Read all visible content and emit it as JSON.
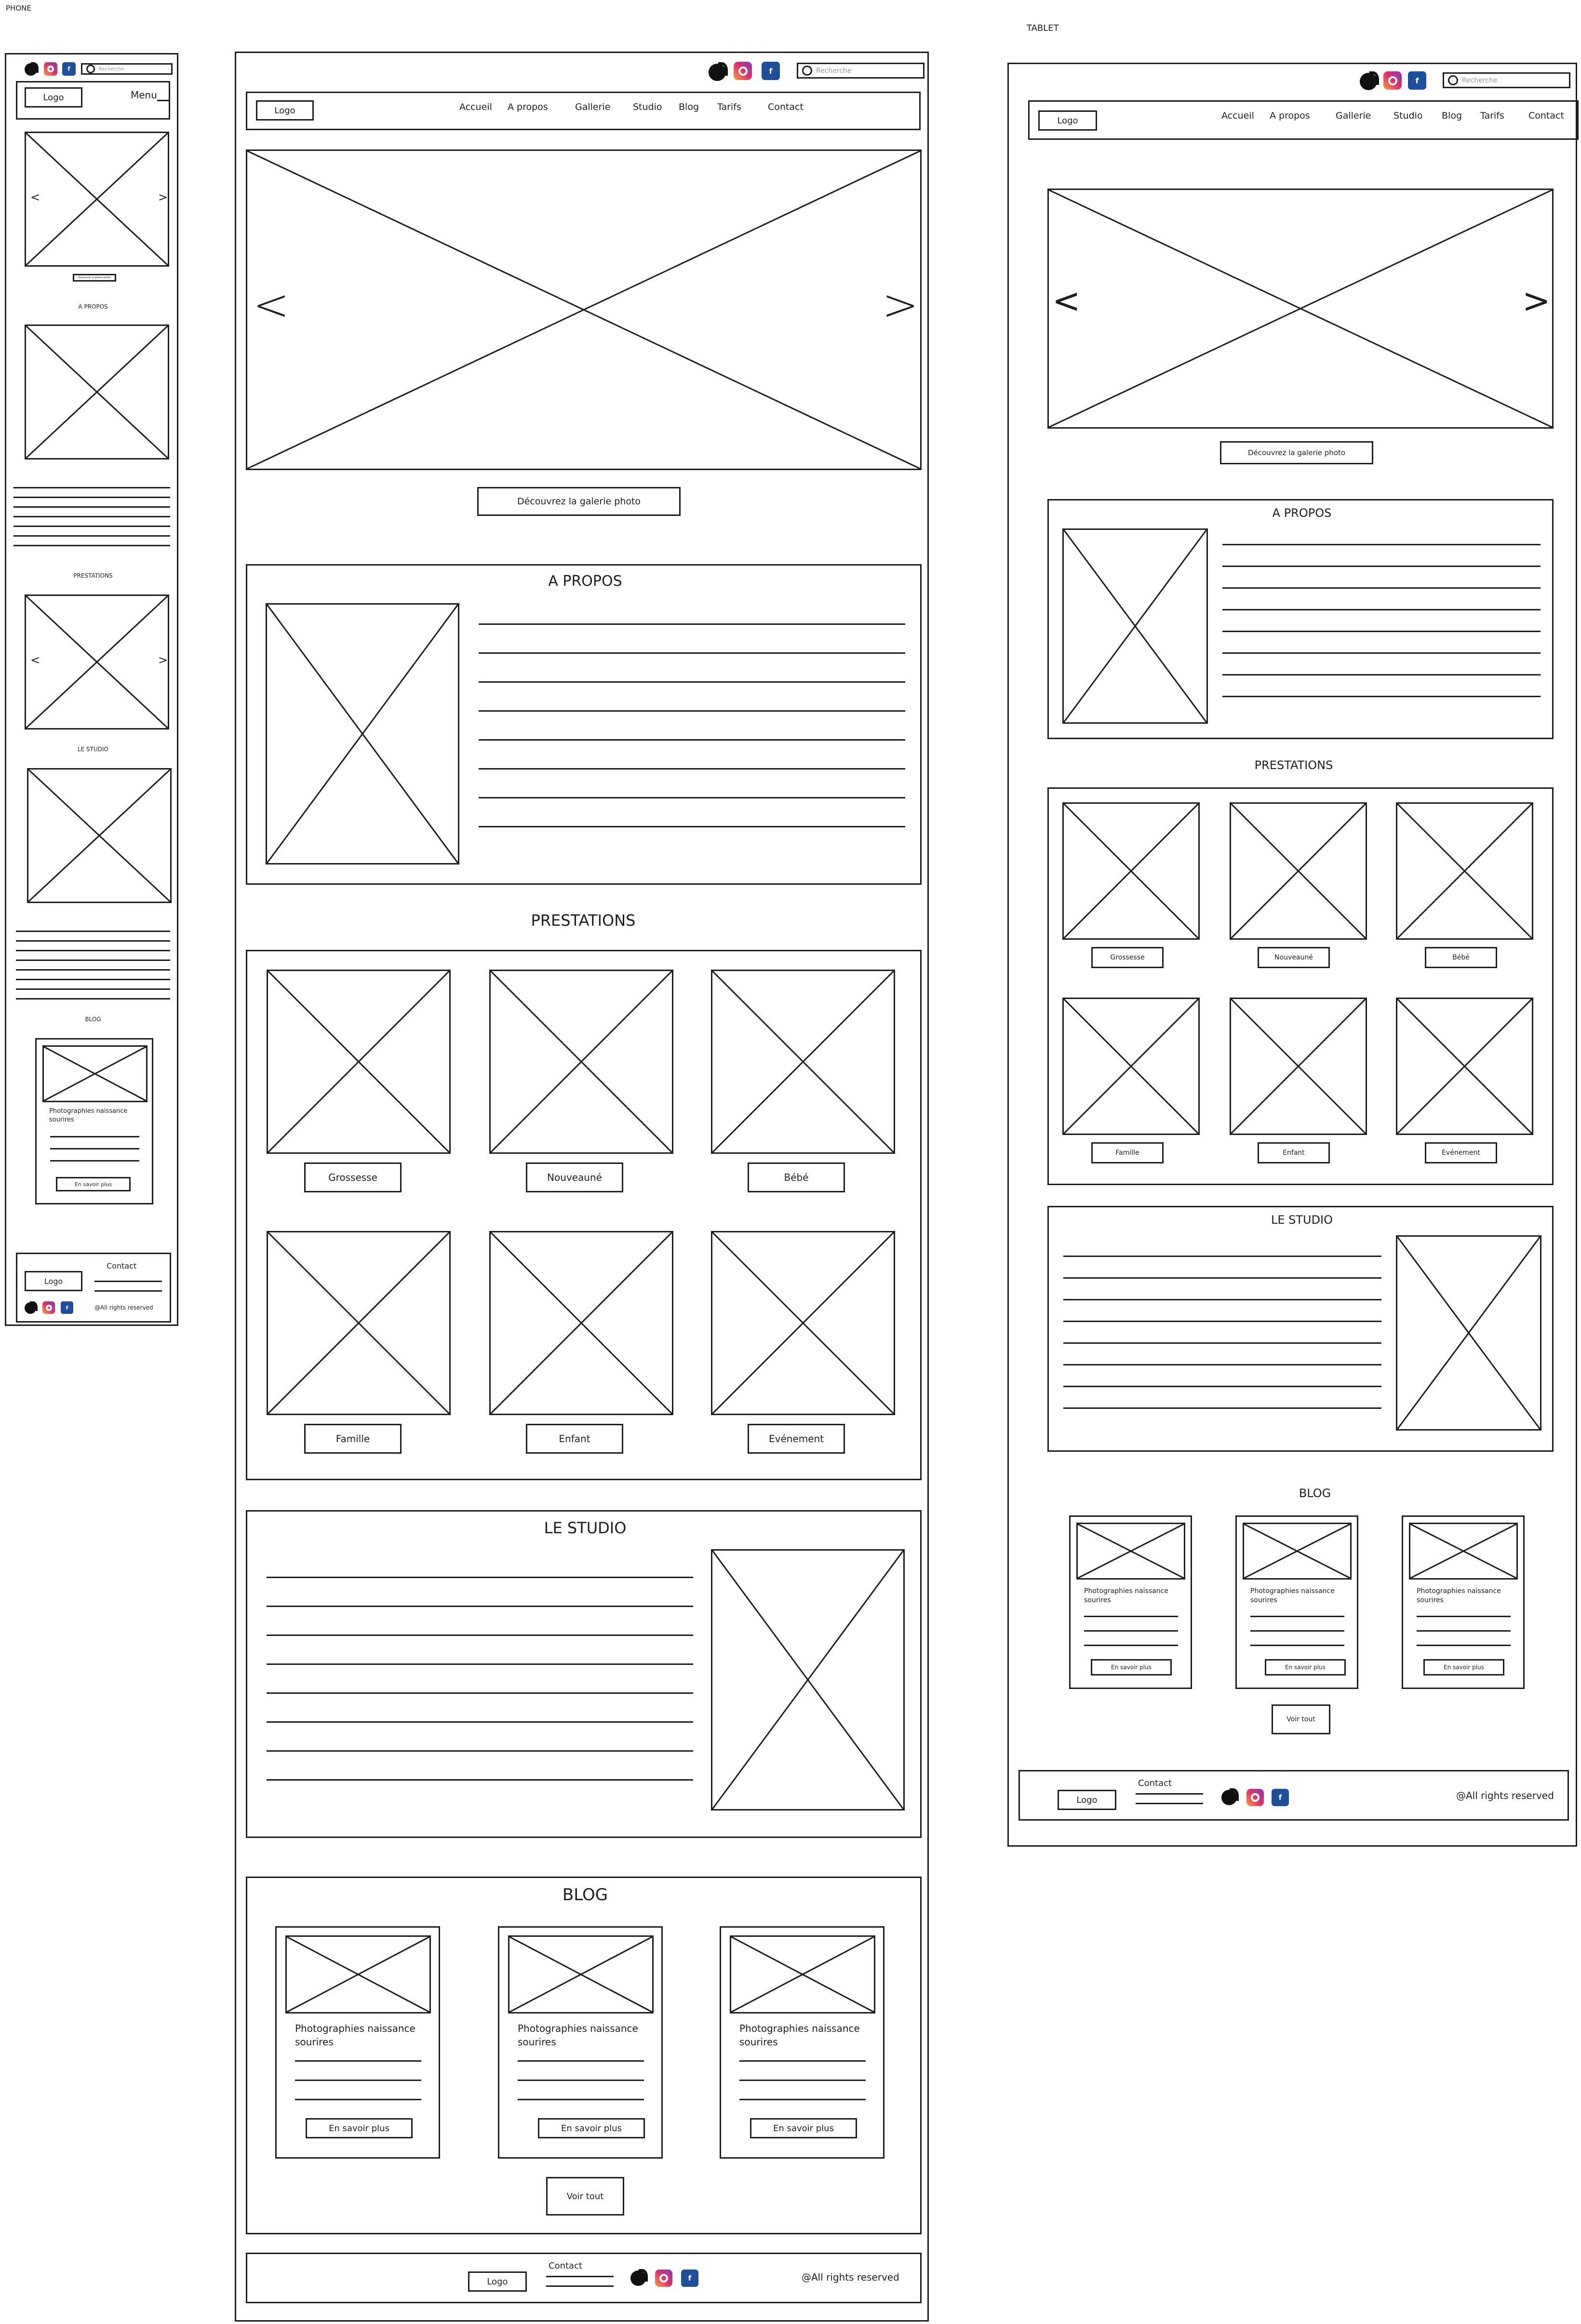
{
  "labels": {
    "phone": "PHONE",
    "tablet": "TABLET"
  },
  "icons": {
    "tiktok": "tiktok-icon",
    "instagram": "instagram-icon",
    "facebook": "facebook-icon",
    "search": "search-icon",
    "prev": "chevron-left-icon",
    "next": "chevron-right-icon",
    "colors": {
      "instagram": "#e1306c",
      "facebook": "#1c4f9c",
      "tiktok": "#111111"
    }
  },
  "header": {
    "search_placeholder": "Recherche",
    "logo": "Logo",
    "menu": "Menu",
    "fb_glyph": "f",
    "nav": [
      "Accueil",
      "A propos",
      "Gallerie",
      "Studio",
      "Blog",
      "Tarifs",
      "Contact"
    ]
  },
  "hero": {
    "gallery_button": "Découvrez la galerie photo",
    "prev_glyph": "<",
    "next_glyph": ">"
  },
  "about": {
    "title": "A PROPOS"
  },
  "services": {
    "title": "PRESTATIONS",
    "items": [
      "Grossesse",
      "Nouveauné",
      "Bébé",
      "Famille",
      "Enfant",
      "Evénement"
    ]
  },
  "studio": {
    "title": "LE STUDIO"
  },
  "blog": {
    "title": "BLOG",
    "card_title": "Photographies naissance sourires",
    "card_button": "En savoir plus",
    "see_all": "Voir tout"
  },
  "footer": {
    "logo": "Logo",
    "contact": "Contact",
    "rights": "@All rights reserved"
  }
}
